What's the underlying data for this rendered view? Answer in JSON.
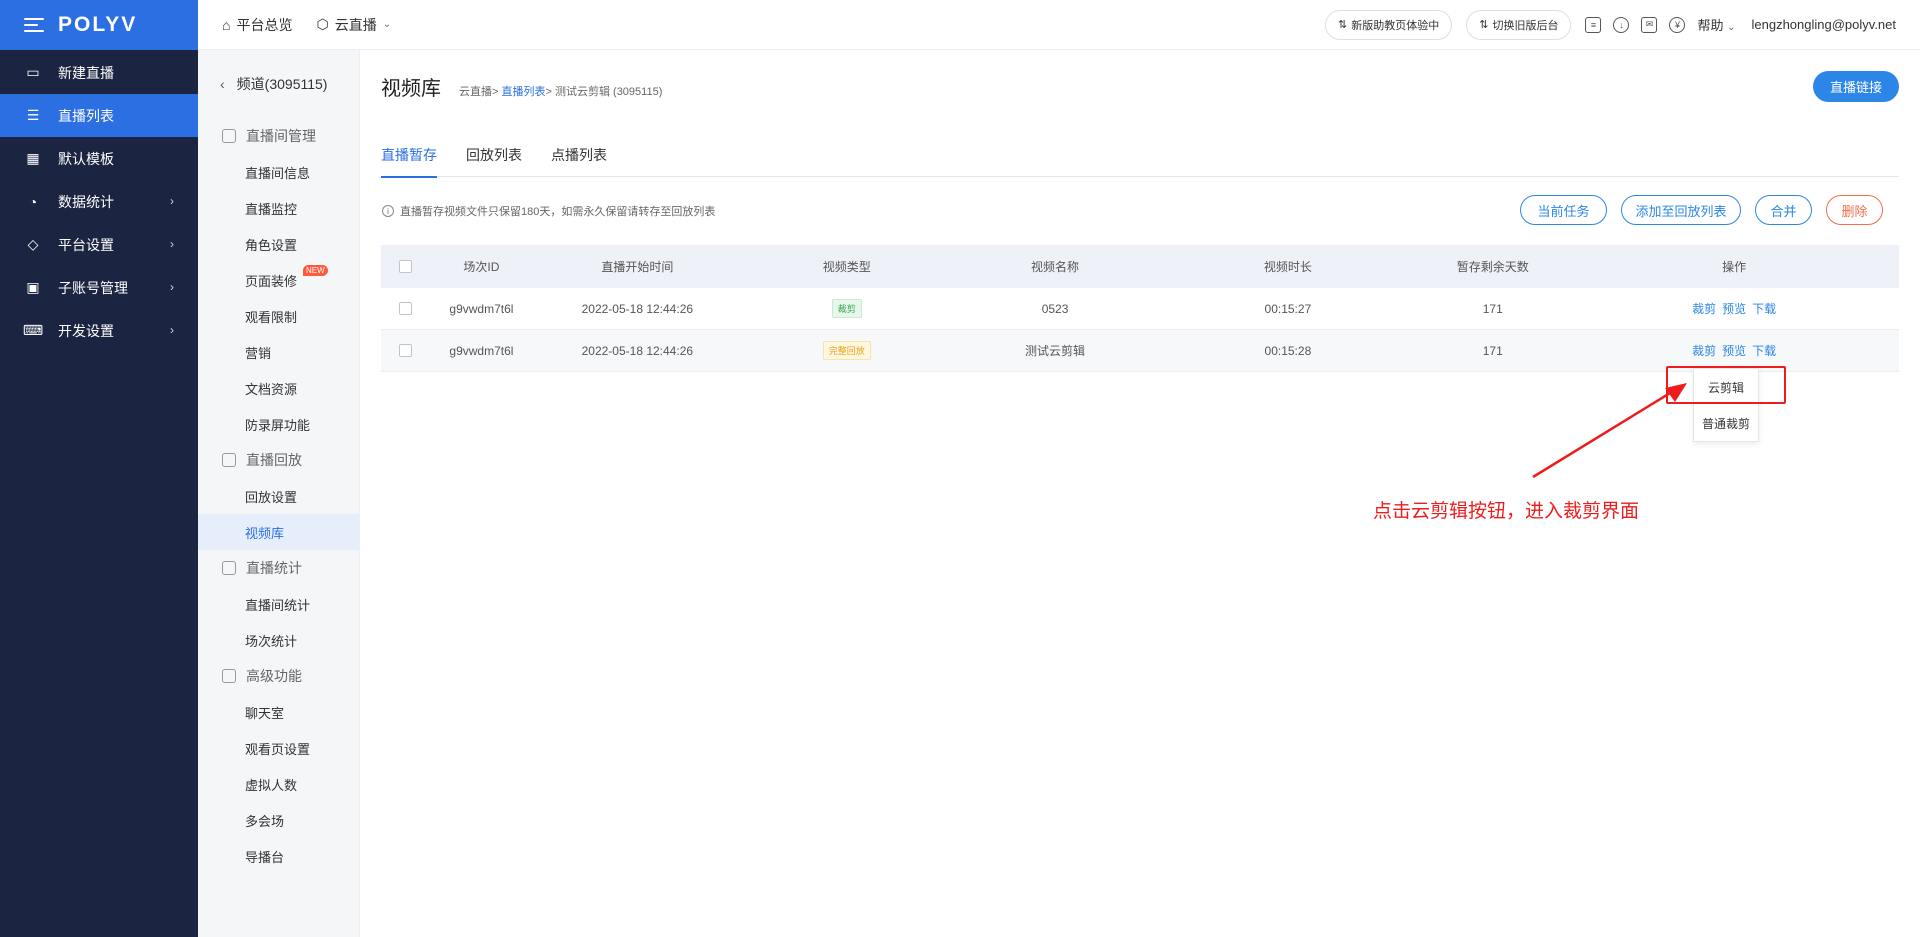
{
  "brand": "POLYV",
  "nav": {
    "items": [
      {
        "label": "新建直播",
        "icon": "video-add-icon",
        "active": false,
        "has_children": false
      },
      {
        "label": "直播列表",
        "icon": "list-icon",
        "active": true,
        "has_children": false
      },
      {
        "label": "默认模板",
        "icon": "template-icon",
        "active": false,
        "has_children": false
      },
      {
        "label": "数据统计",
        "icon": "pie-chart-icon",
        "active": false,
        "has_children": true
      },
      {
        "label": "平台设置",
        "icon": "layers-icon",
        "active": false,
        "has_children": true
      },
      {
        "label": "子账号管理",
        "icon": "id-card-icon",
        "active": false,
        "has_children": true
      },
      {
        "label": "开发设置",
        "icon": "code-icon",
        "active": false,
        "has_children": true
      }
    ]
  },
  "topbar": {
    "overview": "平台总览",
    "cloud_live": "云直播",
    "new_version": "新版助教页体验中",
    "switch_old": "切换旧版后台",
    "help": "帮助",
    "user": "lengzhongling@polyv.net"
  },
  "submenu": {
    "channel": "频道(3095115)",
    "groups": [
      {
        "label": "直播间管理",
        "items": [
          "直播间信息",
          "直播监控",
          "角色设置",
          "页面装修",
          "观看限制",
          "营销",
          "文档资源",
          "防录屏功能"
        ]
      },
      {
        "label": "直播回放",
        "items": [
          "回放设置",
          "视频库"
        ]
      },
      {
        "label": "直播统计",
        "items": [
          "直播间统计",
          "场次统计"
        ]
      },
      {
        "label": "高级功能",
        "items": [
          "聊天室",
          "观看页设置",
          "虚拟人数",
          "多会场",
          "导播台"
        ]
      }
    ],
    "new_badge": "NEW",
    "active_item": "视频库"
  },
  "page": {
    "title": "视频库",
    "crumb": [
      "云直播",
      "直播列表",
      "测试云剪辑 (3095115)"
    ],
    "live_link_btn": "直播链接",
    "tabs": [
      "直播暂存",
      "回放列表",
      "点播列表"
    ],
    "active_tab": 0,
    "notice": "直播暂存视频文件只保留180天，如需永久保留请转存至回放列表",
    "actions": [
      "当前任务",
      "添加至回放列表",
      "合并",
      "删除"
    ]
  },
  "table": {
    "headers": [
      "场次ID",
      "直播开始时间",
      "视频类型",
      "视频名称",
      "视频时长",
      "暂存剩余天数",
      "操作"
    ],
    "rows": [
      {
        "id": "g9vwdm7t6l",
        "start": "2022-05-18 12:44:26",
        "type": "裁剪",
        "type_color": "green",
        "name": "0523",
        "duration": "00:15:27",
        "days": "171"
      },
      {
        "id": "g9vwdm7t6l",
        "start": "2022-05-18 12:44:26",
        "type": "完整回放",
        "type_color": "yellow",
        "name": "测试云剪辑",
        "duration": "00:15:28",
        "days": "171"
      }
    ],
    "ops": [
      "裁剪",
      "预览",
      "下载"
    ]
  },
  "dropdown": [
    "云剪辑",
    "普通裁剪"
  ],
  "annotation": "点击云剪辑按钮，进入裁剪界面",
  "colors": {
    "primary": "#2b86e8",
    "sidebar": "#1b2440",
    "accent_red": "#ee1c1c"
  }
}
